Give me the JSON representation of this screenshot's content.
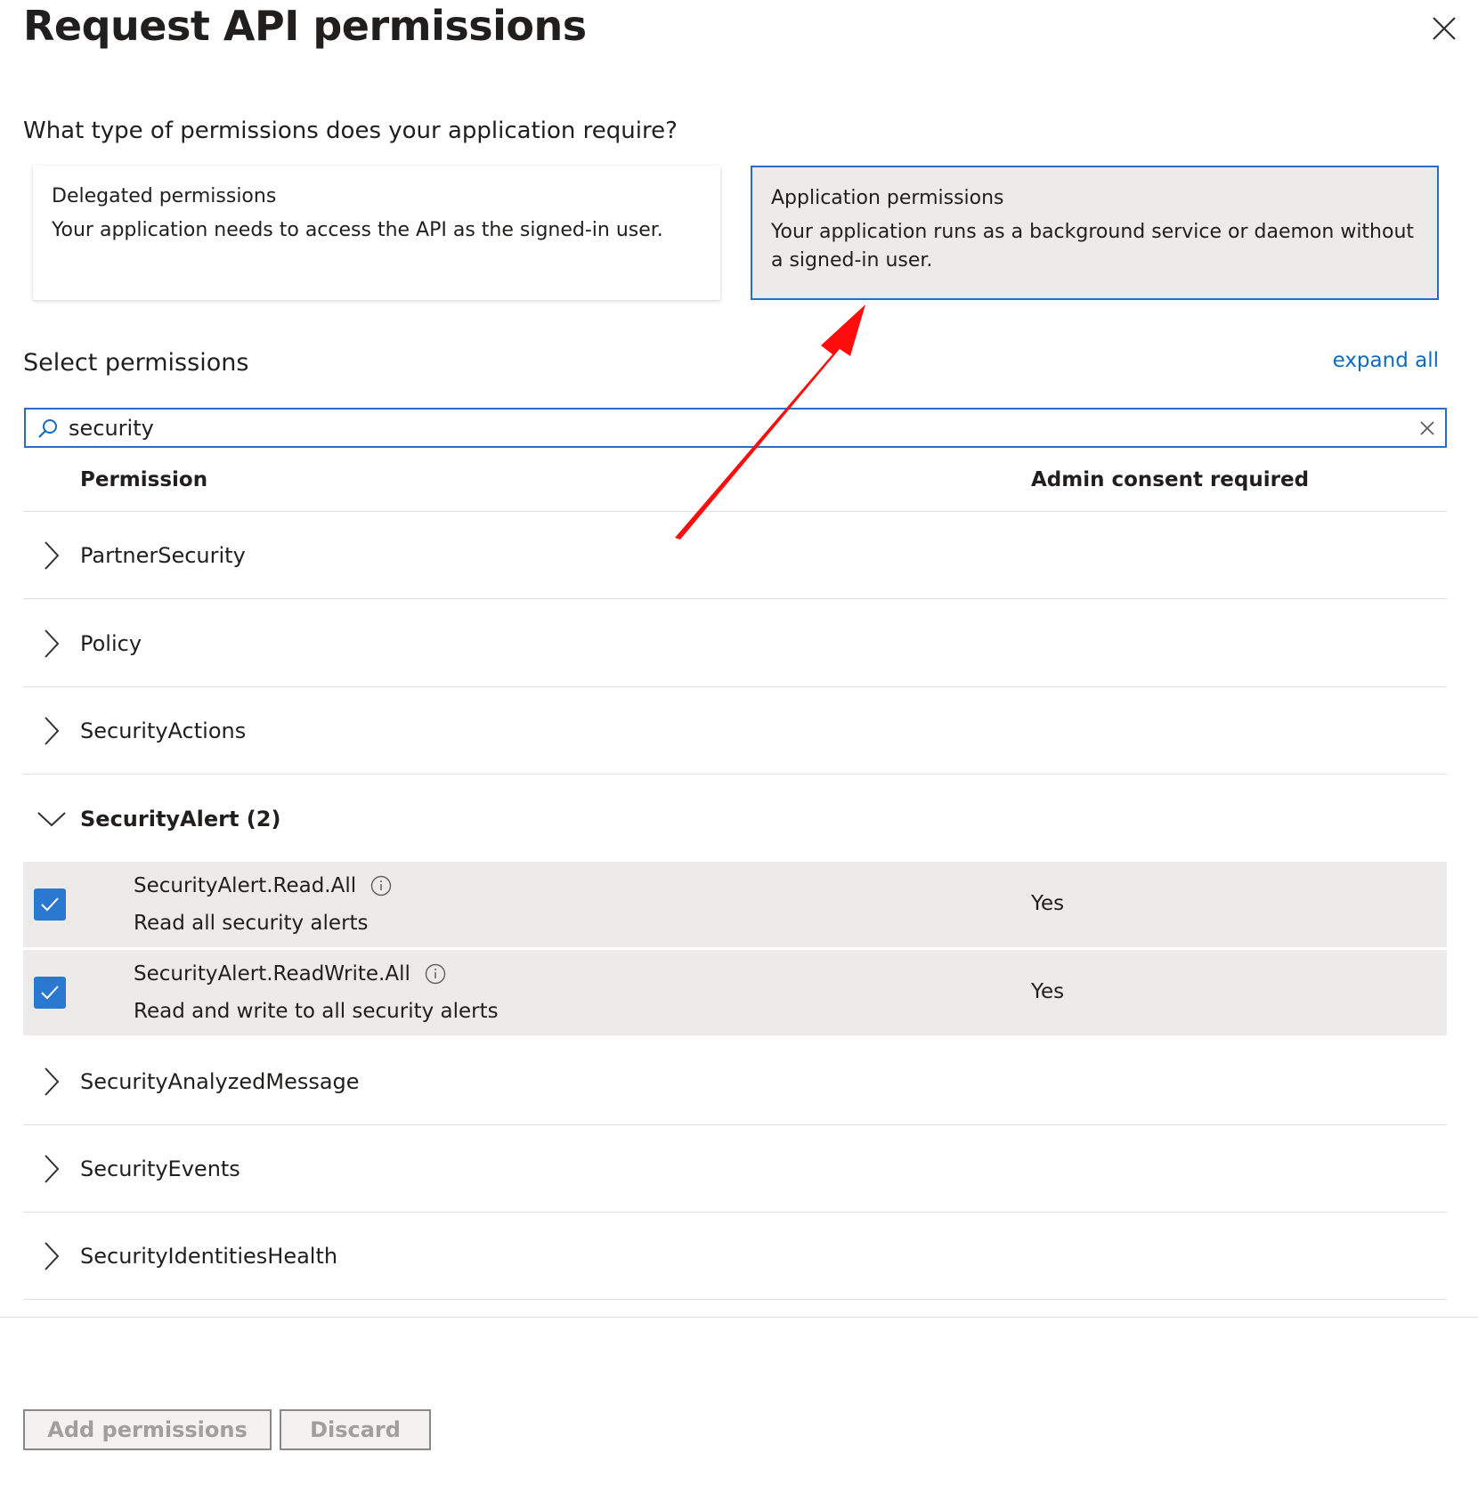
{
  "panel": {
    "title": "Request API permissions",
    "close_icon": "close-icon"
  },
  "question": "What type of permissions does your application require?",
  "permission_types": [
    {
      "title": "Delegated permissions",
      "description": "Your application needs to access the API as the signed-in user.",
      "selected": false
    },
    {
      "title": "Application permissions",
      "description": "Your application runs as a background service or daemon without a signed-in user.",
      "selected": true
    }
  ],
  "select_permissions": {
    "heading": "Select permissions",
    "expand_all": "expand all"
  },
  "search": {
    "value": "security"
  },
  "table": {
    "headers": {
      "permission": "Permission",
      "admin_consent": "Admin consent required"
    },
    "groups_before": [
      "PartnerSecurity",
      "Policy",
      "SecurityActions"
    ],
    "expanded_group": {
      "label": "SecurityAlert (2)",
      "items": [
        {
          "name": "SecurityAlert.Read.All",
          "description": "Read all security alerts",
          "admin_consent": "Yes",
          "checked": true
        },
        {
          "name": "SecurityAlert.ReadWrite.All",
          "description": "Read and write to all security alerts",
          "admin_consent": "Yes",
          "checked": true
        }
      ]
    },
    "groups_after": [
      "SecurityAnalyzedMessage",
      "SecurityEvents",
      "SecurityIdentitiesHealth"
    ]
  },
  "footer": {
    "add_permissions": "Add permissions",
    "discard": "Discard"
  },
  "colors": {
    "accent": "#2b6cc4",
    "checkbox": "#2b78d0",
    "selected_bg": "#edebe9",
    "annotation_arrow": "#ff0000",
    "link": "#0f6cbd"
  }
}
